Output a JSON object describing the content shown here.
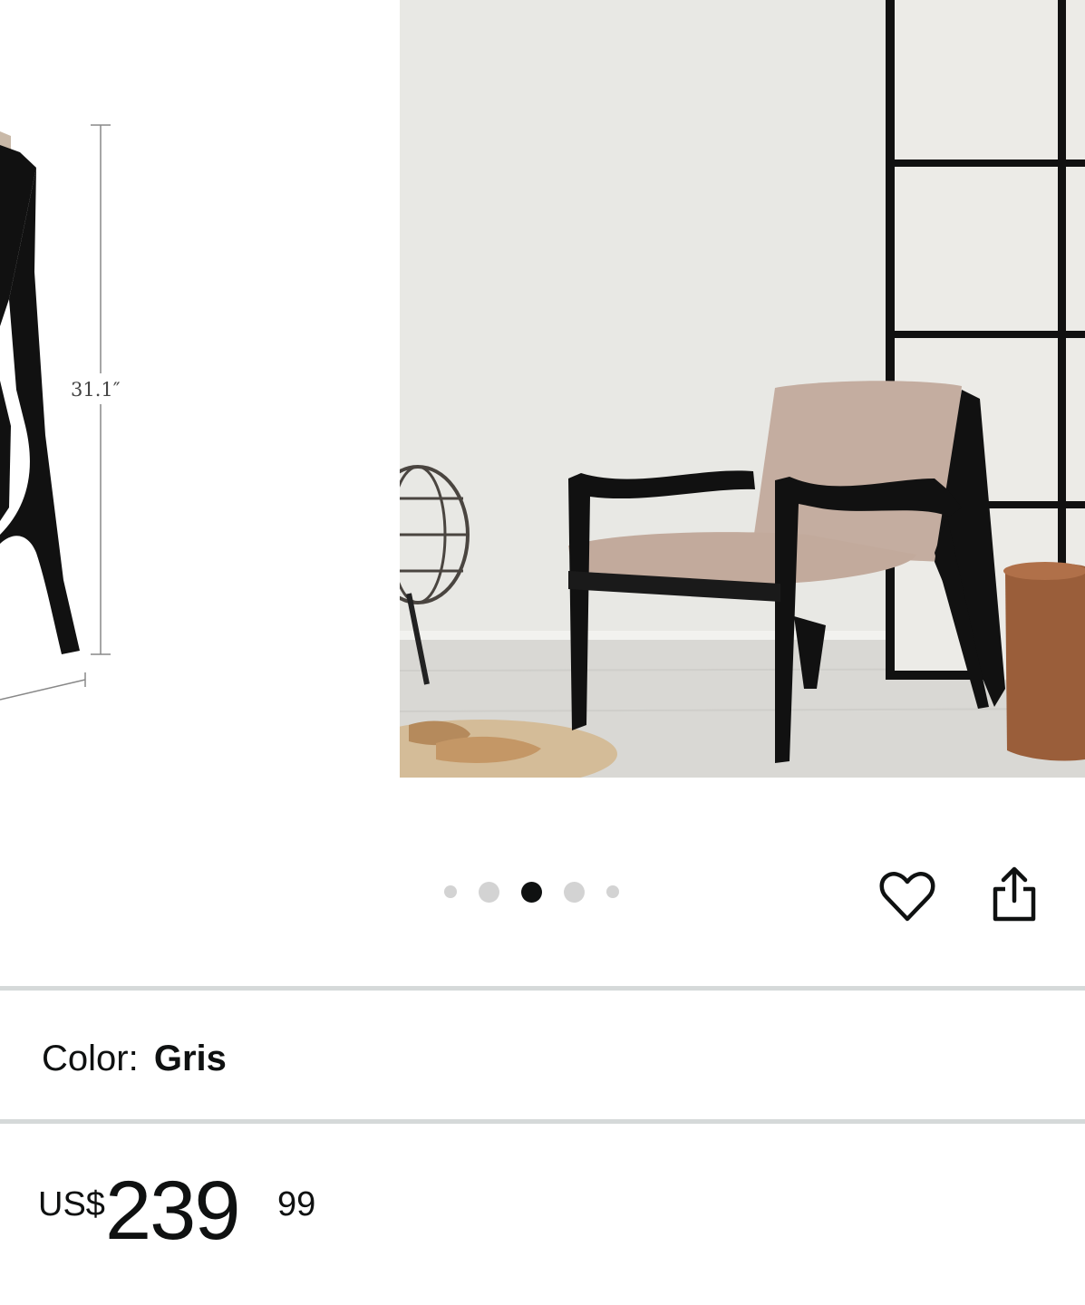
{
  "carousel": {
    "previous_slide": {
      "dimension_label": "31.1″"
    },
    "current_slide": {
      "description": ""
    },
    "dots_count": 5,
    "active_dot": 2
  },
  "actions": {
    "wishlist_icon": "heart-outline-icon",
    "share_icon": "share-icon"
  },
  "variation": {
    "color_label": "Color:",
    "color_value": "Gris"
  },
  "price": {
    "currency": "US$",
    "whole": "239",
    "fraction": "99"
  },
  "colors": {
    "text": "#0f1111",
    "divider": "#d5d9d9",
    "dot_inactive": "#d3d3d3",
    "dot_active": "#0f1111"
  }
}
